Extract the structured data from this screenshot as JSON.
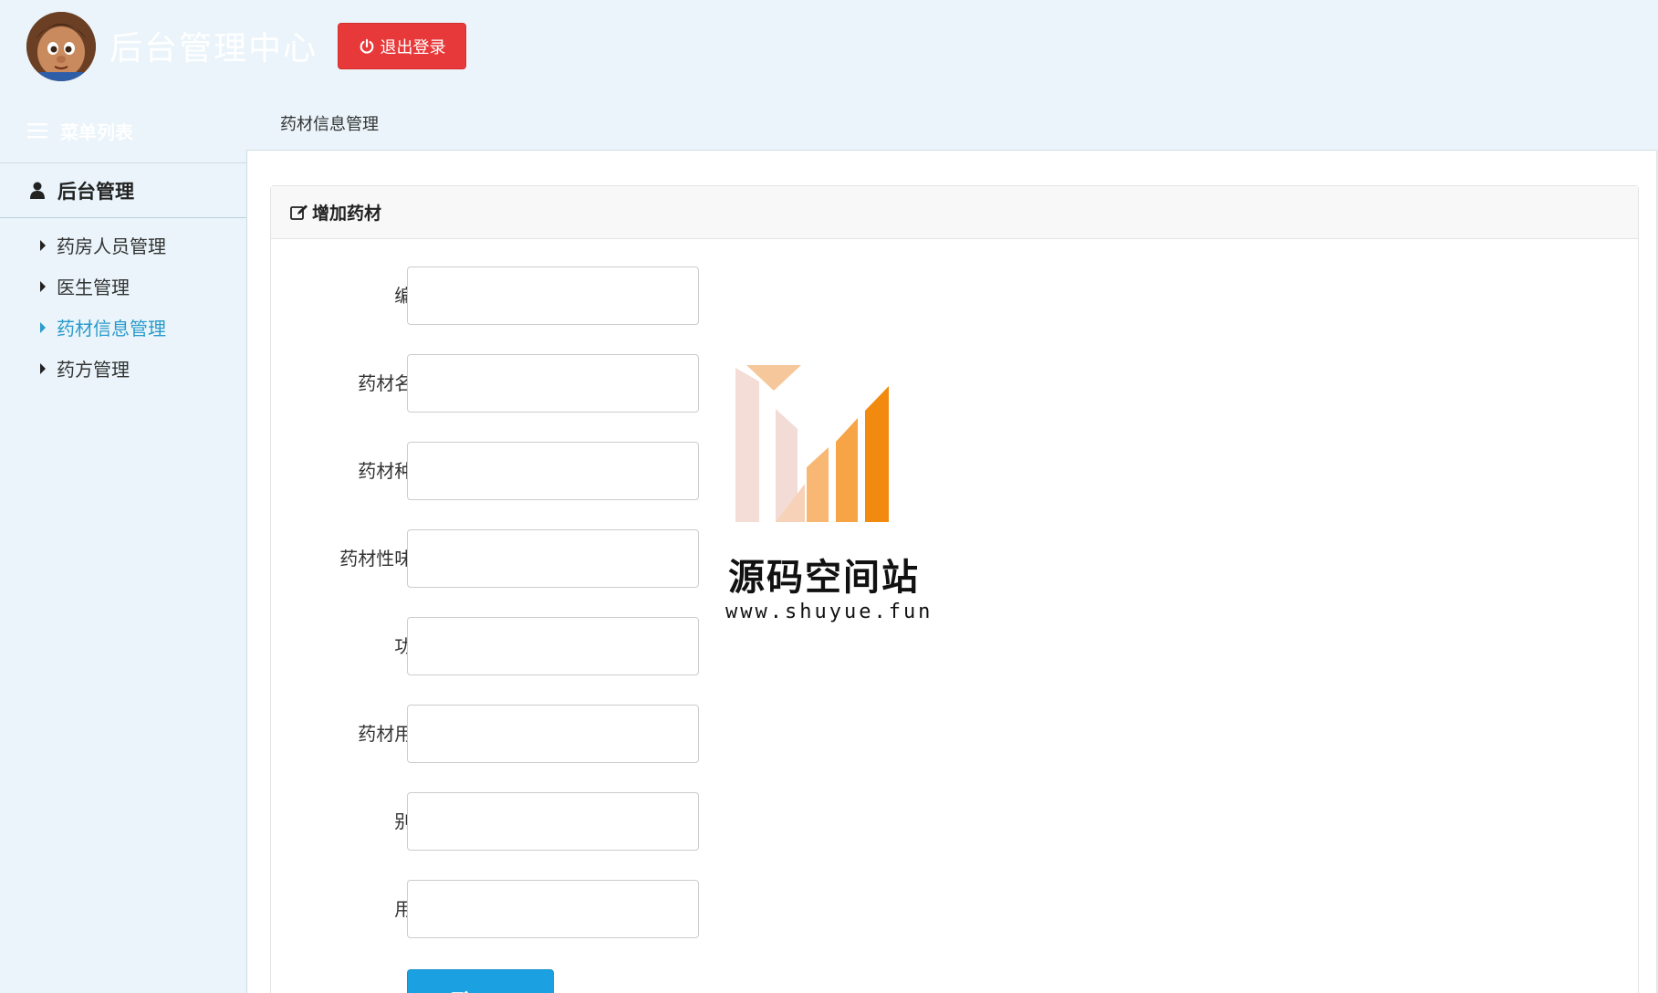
{
  "header": {
    "app_title": "后台管理中心",
    "logout_label": "退出登录"
  },
  "menu": {
    "title": "菜单列表"
  },
  "sidebar": {
    "group_label": "后台管理",
    "items": [
      {
        "label": "药房人员管理",
        "active": false
      },
      {
        "label": "医生管理",
        "active": false
      },
      {
        "label": "药材信息管理",
        "active": true
      },
      {
        "label": "药方管理",
        "active": false
      }
    ]
  },
  "breadcrumb": {
    "tab_label": "药材信息管理"
  },
  "panel": {
    "title": "增加药材",
    "fields": [
      {
        "label": "编号:",
        "value": ""
      },
      {
        "label": "药材名称:",
        "value": ""
      },
      {
        "label": "药材种类:",
        "value": ""
      },
      {
        "label": "药材性味道:",
        "value": ""
      },
      {
        "label": "功效:",
        "value": ""
      },
      {
        "label": "药材用量:",
        "value": ""
      },
      {
        "label": "别名:",
        "value": ""
      },
      {
        "label": "用法:",
        "value": ""
      }
    ],
    "submit_label": "提交"
  },
  "watermark": {
    "title": "源码空间站",
    "url": "www.shuyue.fun"
  },
  "colors": {
    "accent": "#1ba1e2",
    "logout": "#e8393a",
    "active_link": "#2a9bcb",
    "background": "#eaf4fa"
  },
  "icons": {
    "logout": "power-icon",
    "menu": "bars-icon",
    "group": "user-icon",
    "item": "caret-right-icon",
    "panel": "edit-icon",
    "submit": "edit-icon"
  }
}
